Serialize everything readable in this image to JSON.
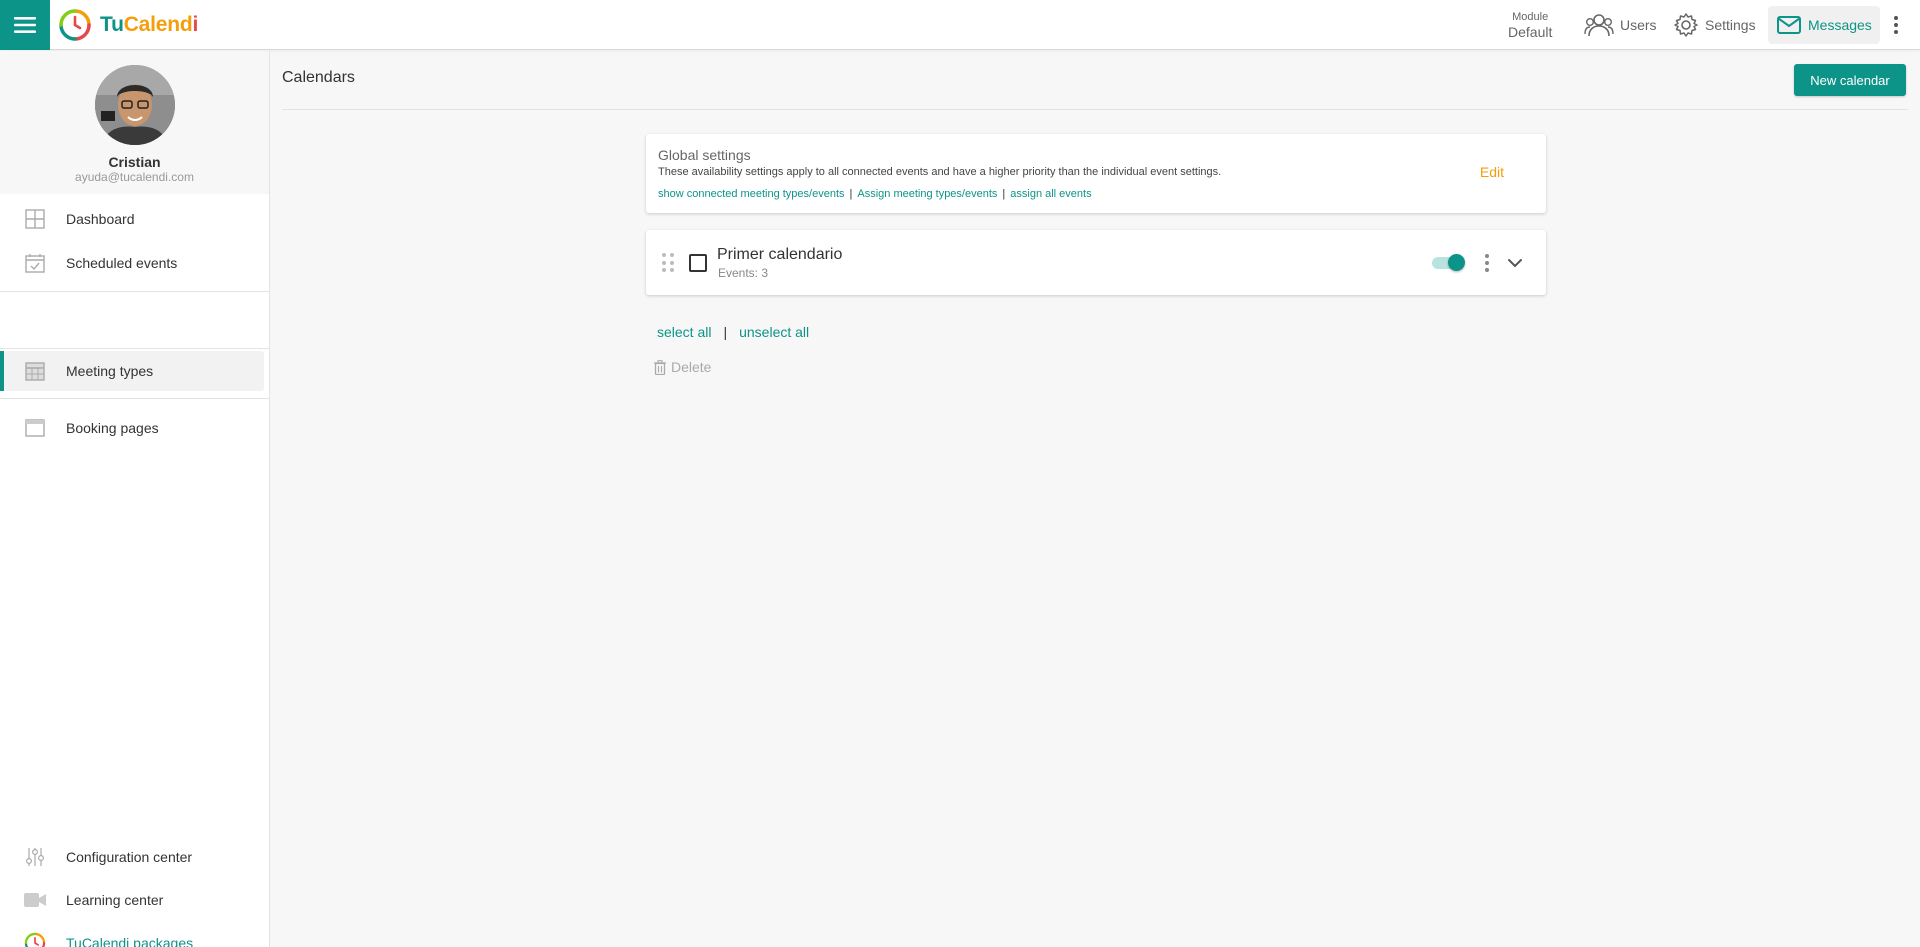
{
  "header": {
    "brand_parts": [
      "Tu",
      "Calend",
      "i"
    ],
    "module_label": "Module",
    "module_value": "Default",
    "nav": {
      "users": "Users",
      "settings": "Settings",
      "messages": "Messages"
    },
    "colors": {
      "accent": "#0d9488",
      "brand_orange": "#f59e0b",
      "brand_red": "#e5484d"
    }
  },
  "sidebar": {
    "profile": {
      "name": "Cristian",
      "email": "ayuda@tucalendi.com"
    },
    "items": [
      {
        "label": "Dashboard",
        "icon": "dashboard-icon"
      },
      {
        "label": "Scheduled events",
        "icon": "calendar-check-icon"
      },
      {
        "label": "Meeting types",
        "icon": "calendar-grid-icon",
        "active": true
      },
      {
        "label": "Booking pages",
        "icon": "browser-window-icon"
      }
    ],
    "bottom_items": [
      {
        "label": "Configuration center",
        "icon": "sliders-icon"
      },
      {
        "label": "Learning center",
        "icon": "video-camera-icon"
      },
      {
        "label": "TuCalendi packages",
        "icon": "tucalendi-logo-icon"
      }
    ]
  },
  "main": {
    "title": "Calendars",
    "new_button": "New calendar",
    "global_settings": {
      "title": "Global settings",
      "description": "These availability settings apply to all connected events and have a higher priority than the individual event settings.",
      "links": [
        "show connected meeting types/events",
        "Assign meeting types/events",
        "assign all events"
      ],
      "separator": "|",
      "edit": "Edit"
    },
    "calendars": [
      {
        "name": "Primer calendario",
        "events": "Events: 3",
        "enabled": true,
        "selected": false
      }
    ],
    "select_all": "select all",
    "separator": "|",
    "unselect_all": "unselect all",
    "delete": "Delete"
  }
}
